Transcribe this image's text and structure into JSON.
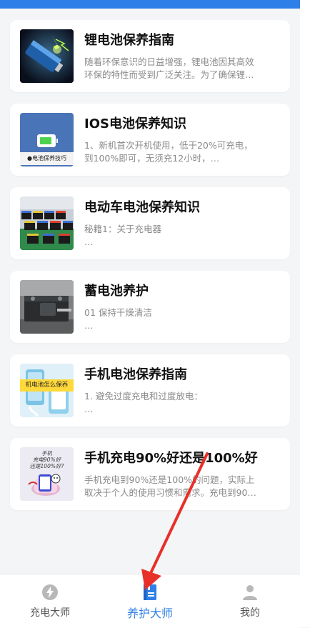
{
  "articles": [
    {
      "title": "锂电池保养指南",
      "desc_line1": "随着环保意识的日益增强，锂电池因其高效",
      "desc_line2": "环保的特性而受到广泛关注。为了确保锂…",
      "icon": "battery-lightning-image"
    },
    {
      "title": "IOS电池保养知识",
      "desc_line1": "1、新机首次开机使用，低于20%可充电，",
      "desc_line2": "到100%即可，无须充12小时，…",
      "icon": "ios-battery-image",
      "thumb_caption": "●电池保养技巧"
    },
    {
      "title": "电动车电池保养知识",
      "desc_line1": "秘籍1：关于充电器",
      "desc_line2": "…",
      "icon": "ev-batteries-image"
    },
    {
      "title": "蓄电池养护",
      "desc_line1": "01 保持干燥清洁",
      "desc_line2": "…",
      "icon": "car-battery-image"
    },
    {
      "title": "手机电池保养指南",
      "desc_line1": "1. 避免过度充电和过度放电：",
      "desc_line2": "…",
      "icon": "phone-battery-image",
      "thumb_caption": "机电池怎么保养"
    },
    {
      "title": "手机充电90%好还是100%好",
      "desc_line1": "手机充电到90%还是100%的问题，实际上",
      "desc_line2": "取决于个人的使用习惯和需求。充电到90…",
      "icon": "phone-charging-cartoon-image",
      "thumb_caption_line1": "手机",
      "thumb_caption_line2": "充电90%好",
      "thumb_caption_line3": "还是100%好?"
    }
  ],
  "tabbar": {
    "tabs": [
      {
        "label": "充电大师",
        "icon": "lightning-circle-icon",
        "active": false
      },
      {
        "label": "养护大师",
        "icon": "notebook-icon",
        "active": true
      },
      {
        "label": "我的",
        "icon": "user-icon",
        "active": false
      }
    ]
  },
  "colors": {
    "accent": "#2f7fe8",
    "inactive": "#b8b8b8",
    "annotation_arrow": "#e8302a"
  }
}
